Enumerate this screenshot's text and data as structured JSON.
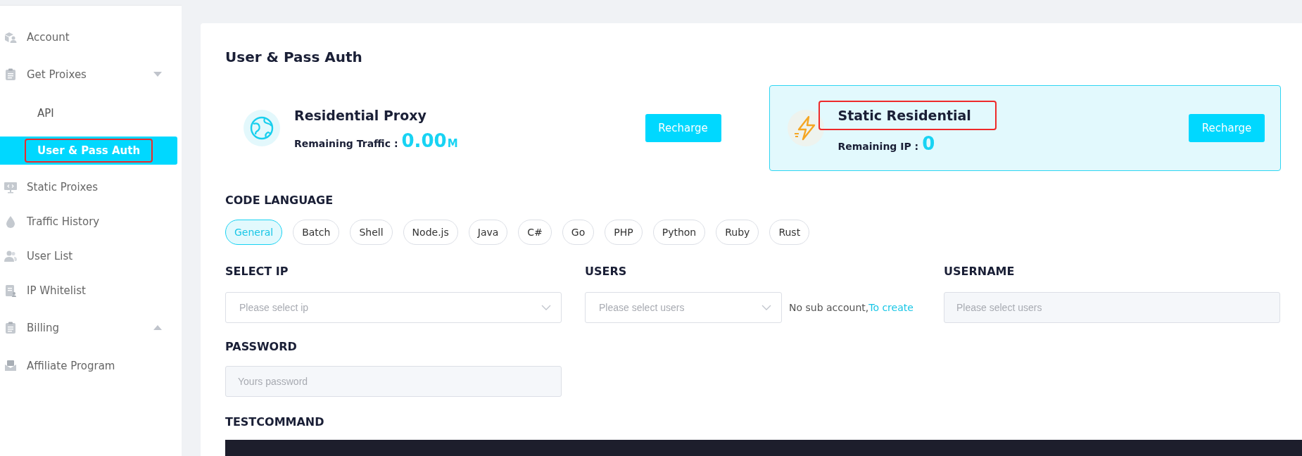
{
  "sidebar": {
    "items": [
      {
        "kind": "item",
        "label": "Account"
      },
      {
        "kind": "group",
        "label": "Get Proixes",
        "expanded": true,
        "children": [
          {
            "label": "API",
            "selected": false,
            "annotated": false
          },
          {
            "label": "User & Pass Auth",
            "selected": true,
            "annotated": true
          }
        ]
      },
      {
        "kind": "item",
        "label": "Static Proixes"
      },
      {
        "kind": "item",
        "label": "Traffic History"
      },
      {
        "kind": "item",
        "label": "User List"
      },
      {
        "kind": "item",
        "label": "IP Whitelist"
      },
      {
        "kind": "group",
        "label": "Billing",
        "expanded": false
      },
      {
        "kind": "item",
        "label": "Affiliate Program"
      }
    ]
  },
  "page": {
    "title": "User & Pass Auth",
    "products": [
      {
        "title": "Residential Proxy",
        "annotated": false,
        "selected": false,
        "metric_label": "Remaining Traffic :",
        "metric_value": "0.00",
        "metric_unit": "M",
        "button": "Recharge"
      },
      {
        "title": "Static Residential",
        "annotated": true,
        "selected": true,
        "metric_label": "Remaining IP :",
        "metric_value": "0",
        "button": "Recharge"
      }
    ],
    "code_language": {
      "label": "CODE LANGUAGE",
      "options": [
        {
          "label": "General",
          "selected": true
        },
        {
          "label": "Batch",
          "selected": false
        },
        {
          "label": "Shell",
          "selected": false
        },
        {
          "label": "Node.js",
          "selected": false
        },
        {
          "label": "Java",
          "selected": false
        },
        {
          "label": "C#",
          "selected": false
        },
        {
          "label": "Go",
          "selected": false
        },
        {
          "label": "PHP",
          "selected": false
        },
        {
          "label": "Python",
          "selected": false
        },
        {
          "label": "Ruby",
          "selected": false
        },
        {
          "label": "Rust",
          "selected": false
        }
      ]
    },
    "select_ip": {
      "label": "SELECT IP",
      "placeholder": "Please select ip"
    },
    "users": {
      "label": "USERS",
      "placeholder": "Please select users",
      "note": "No sub account,",
      "link": "To create"
    },
    "username": {
      "label": "USERNAME",
      "placeholder": "Please select users"
    },
    "password": {
      "label": "PASSWORD",
      "placeholder": "Yours password"
    },
    "test_command": {
      "label": "TESTCOMMAND"
    }
  }
}
